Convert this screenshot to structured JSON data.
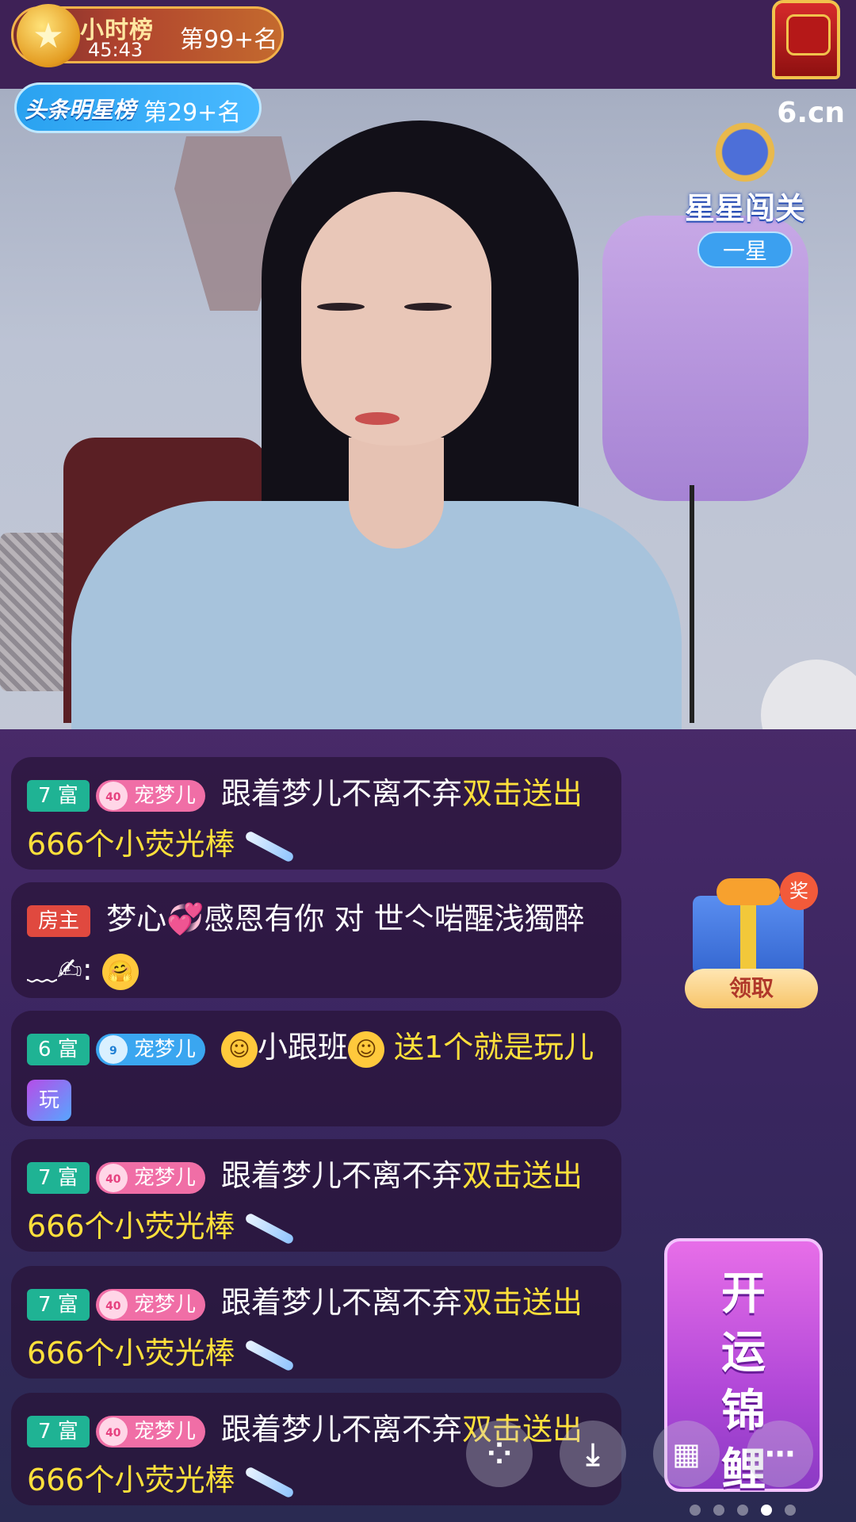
{
  "header": {
    "hour_rank_title": "小时榜",
    "hour_rank_timer": "45:43",
    "hour_rank_position": "第99+名"
  },
  "video": {
    "watermark": "6.cn",
    "headline_rank_logo": "头条明星榜",
    "headline_rank_position": "第29+名",
    "star_challenge_title": "星星闯关",
    "star_challenge_level": "一星"
  },
  "chat": {
    "messages": [
      {
        "level": "7 富",
        "fan_badge": "宠梦儿",
        "fan_level": "40",
        "text_white": "跟着梦儿不离不弃",
        "text_yellow": "双击送出666个小荧光棒"
      },
      {
        "role": "房主",
        "text": "梦心💞感恩有你 对 世亽啱醒浅獨醉﹏✍:",
        "emoji": "🤗"
      },
      {
        "level": "6 富",
        "fan_badge": "宠梦儿",
        "fan_level": "9",
        "text_white": "小跟班",
        "text_yellow": "送1个就是玩儿",
        "gift_icon": "玩"
      },
      {
        "level": "7 富",
        "fan_badge": "宠梦儿",
        "fan_level": "40",
        "text_white": "跟着梦儿不离不弃",
        "text_yellow": "双击送出666个小荧光棒"
      },
      {
        "level": "7 富",
        "fan_badge": "宠梦儿",
        "fan_level": "40",
        "text_white": "跟着梦儿不离不弃",
        "text_yellow": "双击送出666个小荧光棒"
      },
      {
        "level": "7 富",
        "fan_badge": "宠梦儿",
        "fan_level": "40",
        "text_white": "跟着梦儿不离不弃",
        "text_yellow": "双击送出666个小荧光棒"
      }
    ]
  },
  "side": {
    "gift_corner": "奖",
    "gift_claim": "领取",
    "fortune_text": "开运锦鲤"
  },
  "toolbar": {
    "icons": [
      "share-icon",
      "download-icon",
      "grid-icon",
      "more-icon"
    ],
    "page_count": 5,
    "active_page": 4
  }
}
